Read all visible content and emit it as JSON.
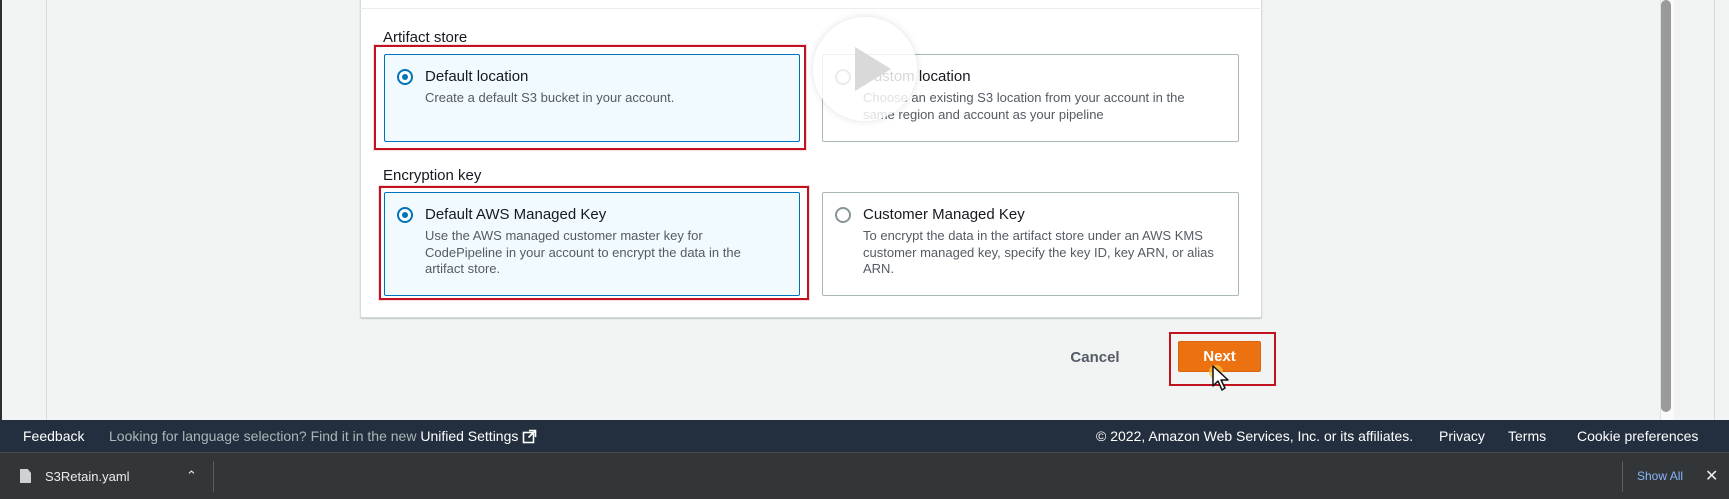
{
  "artifact_store": {
    "label": "Artifact store",
    "options": [
      {
        "title": "Default location",
        "desc": [
          "Create a default S3 bucket in your account."
        ],
        "selected": true
      },
      {
        "title": "Custom location",
        "desc": [
          "Choose an existing S3 location from your account in the",
          "same region and account as your pipeline"
        ],
        "selected": false
      }
    ]
  },
  "encryption_key": {
    "label": "Encryption key",
    "options": [
      {
        "title": "Default AWS Managed Key",
        "desc": [
          "Use the AWS managed customer master key for",
          "CodePipeline in your account to encrypt the data in the",
          "artifact store."
        ],
        "selected": true
      },
      {
        "title": "Customer Managed Key",
        "desc": [
          "To encrypt the data in the artifact store under an AWS KMS",
          "customer managed key, specify the key ID, key ARN, or alias",
          "ARN."
        ],
        "selected": false
      }
    ]
  },
  "actions": {
    "cancel_label": "Cancel",
    "next_label": "Next"
  },
  "footer": {
    "feedback": "Feedback",
    "lang_prefix": "Looking for language selection? Find it in the new ",
    "lang_link": "Unified Settings",
    "copyright": "© 2022, Amazon Web Services, Inc. or its affiliates.",
    "privacy": "Privacy",
    "terms": "Terms",
    "cookie": "Cookie preferences"
  },
  "download_bar": {
    "file_name": "S3Retain.yaml",
    "show_all": "Show All"
  },
  "colors": {
    "accent": "#0073bb",
    "primary_button": "#ec7211",
    "highlight": "#c0121f",
    "footer_bg": "#232f3e"
  },
  "icons": {
    "play_overlay": "play-icon",
    "external_link": "external-link-icon",
    "close": "close-icon",
    "file": "file-icon",
    "chevron": "chevron-up-icon"
  }
}
